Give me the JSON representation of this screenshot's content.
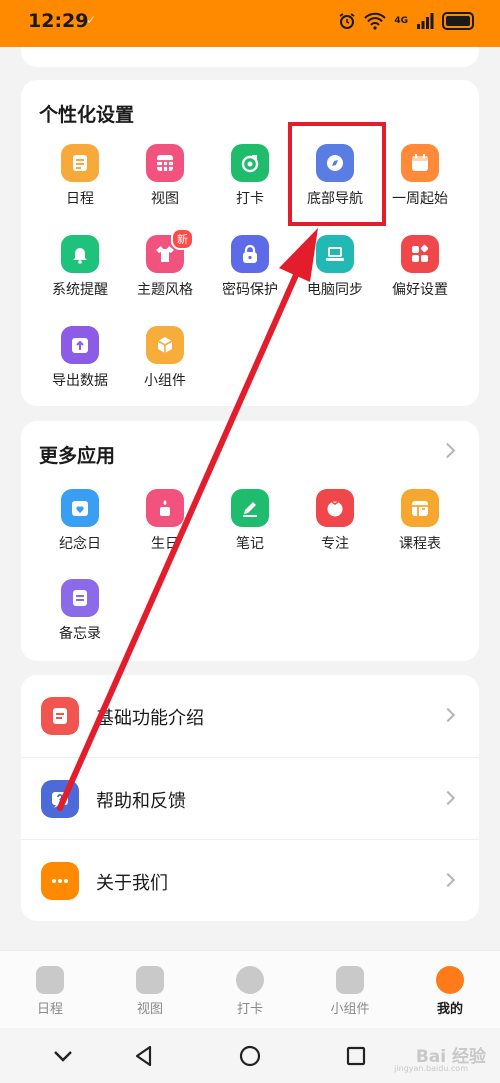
{
  "status": {
    "time": "12:29",
    "check": "✓",
    "network": "4G"
  },
  "personal": {
    "title": "个性化设置",
    "items": [
      {
        "label": "日程",
        "color": "#f7a93a",
        "icon": "calendar-doc-icon"
      },
      {
        "label": "视图",
        "color": "#f1527e",
        "icon": "grid-view-icon"
      },
      {
        "label": "打卡",
        "color": "#1fbc6c",
        "icon": "target-check-icon"
      },
      {
        "label": "底部导航",
        "color": "#5a7de4",
        "icon": "compass-icon"
      },
      {
        "label": "一周起始",
        "color": "#ff8a3a",
        "icon": "week-calendar-icon"
      },
      {
        "label": "系统提醒",
        "color": "#1ec27a",
        "icon": "bell-icon"
      },
      {
        "label": "主题风格",
        "color": "#f1527e",
        "icon": "tshirt-icon",
        "badge": "新"
      },
      {
        "label": "密码保护",
        "color": "#5d6be8",
        "icon": "lock-icon"
      },
      {
        "label": "电脑同步",
        "color": "#22b9b4",
        "icon": "laptop-icon"
      },
      {
        "label": "偏好设置",
        "color": "#f0474a",
        "icon": "preferences-icon"
      },
      {
        "label": "导出数据",
        "color": "#8c5ce6",
        "icon": "export-icon"
      },
      {
        "label": "小组件",
        "color": "#f6ad3b",
        "icon": "widget-cube-icon"
      }
    ]
  },
  "more": {
    "title": "更多应用",
    "items": [
      {
        "label": "纪念日",
        "color": "#3a9ef2",
        "icon": "anniversary-icon"
      },
      {
        "label": "生日",
        "color": "#f1527e",
        "icon": "birthday-icon"
      },
      {
        "label": "笔记",
        "color": "#1ebc6c",
        "icon": "pencil-icon"
      },
      {
        "label": "专注",
        "color": "#f0474a",
        "icon": "tomato-icon"
      },
      {
        "label": "课程表",
        "color": "#f6a730",
        "icon": "timetable-icon"
      },
      {
        "label": "备忘录",
        "color": "#8c6be8",
        "icon": "memo-icon"
      }
    ]
  },
  "info": {
    "items": [
      {
        "label": "基础功能介绍",
        "color": "#f0564f",
        "icon": "intro-doc-icon"
      },
      {
        "label": "帮助和反馈",
        "color": "#4d6bd8",
        "icon": "help-icon"
      },
      {
        "label": "关于我们",
        "color": "#ff8a00",
        "icon": "more-dots-icon"
      }
    ]
  },
  "tabs": [
    {
      "label": "日程"
    },
    {
      "label": "视图"
    },
    {
      "label": "打卡"
    },
    {
      "label": "小组件"
    },
    {
      "label": "我的"
    }
  ],
  "watermark": {
    "brand": "Bai 经验",
    "url": "jingyan.baidu.com"
  }
}
